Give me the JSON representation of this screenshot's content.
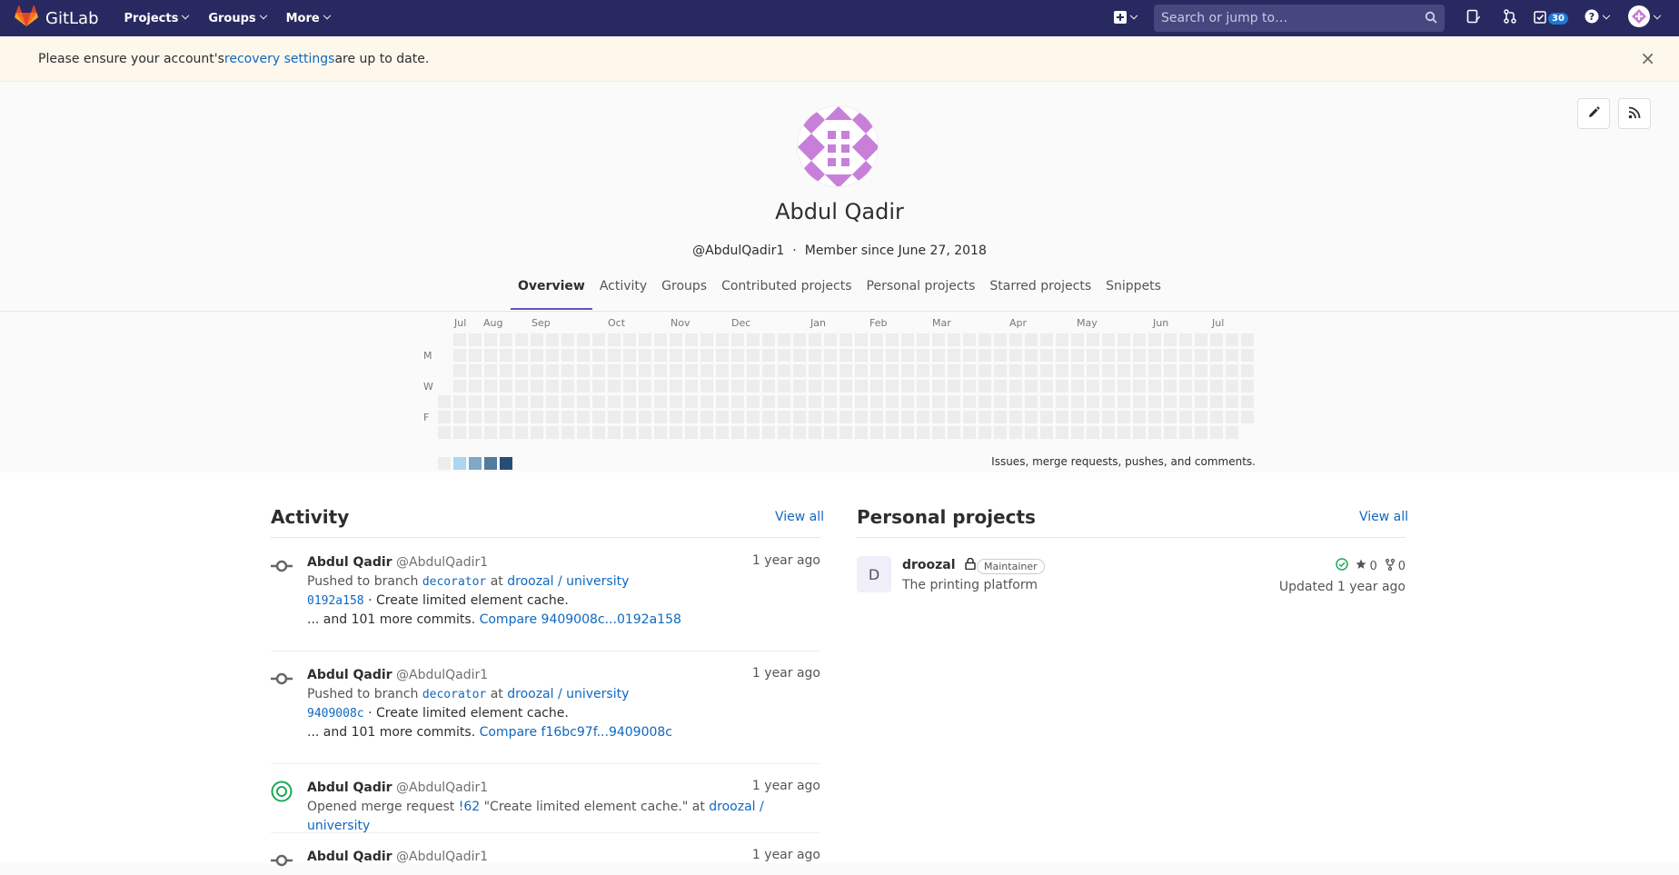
{
  "navbar": {
    "brand": "GitLab",
    "menu": [
      "Projects",
      "Groups",
      "More"
    ],
    "search_placeholder": "Search or jump to…",
    "todos_count": "30"
  },
  "alert": {
    "text_before": "Please ensure your account's ",
    "link": "recovery settings",
    "text_after": " are up to date.",
    "close": "×"
  },
  "profile": {
    "name": "Abdul Qadir",
    "handle": "@AbdulQadir1",
    "separator": "·",
    "member_since": "Member since June 27, 2018",
    "tabs": [
      "Overview",
      "Activity",
      "Groups",
      "Contributed projects",
      "Personal projects",
      "Starred projects",
      "Snippets"
    ],
    "active_tab": "Overview"
  },
  "calendar": {
    "months": [
      "Jul",
      "Aug",
      "Sep",
      "Oct",
      "Nov",
      "Dec",
      "Jan",
      "Feb",
      "Mar",
      "Apr",
      "May",
      "Jun",
      "Jul"
    ],
    "days": [
      "M",
      "W",
      "F"
    ],
    "legend_colors": [
      "#ededed",
      "#acd5f2",
      "#7fa8c9",
      "#527ba0",
      "#254e77"
    ],
    "caption": "Issues, merge requests, pushes, and comments.",
    "empty_color": "#ededed"
  },
  "activity": {
    "title": "Activity",
    "view_all": "View all",
    "events": [
      {
        "author": "Abdul Qadir",
        "handle": "@AbdulQadir1",
        "time": "1 year ago",
        "action": "Pushed to branch ",
        "branch": "decorator",
        "at": " at ",
        "project": "droozal / university",
        "sha": "0192a158",
        "commit_msg": " · Create limited element cache.",
        "more": "... and 101 more commits. ",
        "compare": "Compare 9409008c...0192a158"
      },
      {
        "author": "Abdul Qadir",
        "handle": "@AbdulQadir1",
        "time": "1 year ago",
        "action": "Pushed to branch ",
        "branch": "decorator",
        "at": " at ",
        "project": "droozal / university",
        "sha": "9409008c",
        "commit_msg": " · Create limited element cache.",
        "more": "... and 101 more commits. ",
        "compare": "Compare f16bc97f...9409008c"
      },
      {
        "author": "Abdul Qadir",
        "handle": "@AbdulQadir1",
        "time": "1 year ago",
        "action": "Opened merge request ",
        "mr": "!62",
        "mr_title": " \"Create limited element cache.\" at ",
        "project": "droozal / university"
      },
      {
        "author": "Abdul Qadir",
        "handle": "@AbdulQadir1",
        "time": "1 year ago"
      }
    ]
  },
  "projects": {
    "title": "Personal projects",
    "view_all": "View all",
    "items": [
      {
        "avatar_letter": "D",
        "name": "droozal",
        "role": "Maintainer",
        "description": "The printing platform",
        "stars": "0",
        "forks": "0",
        "updated": "Updated 1 year ago"
      }
    ]
  },
  "colors": {
    "navbar": "#292961",
    "link": "#1068bf",
    "alert_bg": "#fdf7ec",
    "tab_underline": "#6b4fbb",
    "identicon": "#c77fd9",
    "mr_icon": "#1aaa55"
  }
}
